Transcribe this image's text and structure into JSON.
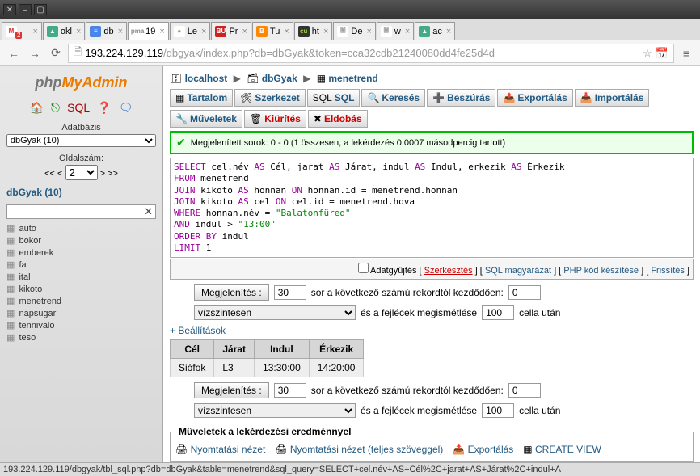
{
  "window": {
    "url_host": "193.224.129.119",
    "url_path": "/dbgyak/index.php?db=dbGyak&token=cca32cdb21240080dd4fe25d4d"
  },
  "browser_tabs": [
    {
      "label": "",
      "badge": "2",
      "ico": "M",
      "ico_bg": "#fff",
      "ico_color": "#d33"
    },
    {
      "label": "okl",
      "ico": "▲",
      "ico_bg": "#4a8",
      "ico_color": "#fff"
    },
    {
      "label": "db",
      "ico": "≡",
      "ico_bg": "#4a86e8",
      "ico_color": "#fff"
    },
    {
      "label": "19",
      "ico": "pma",
      "ico_bg": "#fff",
      "ico_color": "#888",
      "active": true
    },
    {
      "label": "Le",
      "ico": "●",
      "ico_bg": "#fff",
      "ico_color": "#7b5"
    },
    {
      "label": "Pr",
      "ico": "BU",
      "ico_bg": "#c22",
      "ico_color": "#fff"
    },
    {
      "label": "Tu",
      "ico": "B",
      "ico_bg": "#f80",
      "ico_color": "#fff"
    },
    {
      "label": "ht",
      "ico": "cu",
      "ico_bg": "#333",
      "ico_color": "#9c4"
    },
    {
      "label": "De",
      "ico": "🗎",
      "ico_bg": "#fff",
      "ico_color": "#888"
    },
    {
      "label": "w",
      "ico": "🗎",
      "ico_bg": "#fff",
      "ico_color": "#888"
    },
    {
      "label": "ac",
      "ico": "▲",
      "ico_bg": "#4a8",
      "ico_color": "#fff"
    }
  ],
  "sidebar": {
    "db_label": "Adatbázis",
    "db_select": "dbGyak (10)",
    "page_label": "Oldalszám:",
    "pager_prev": "<< <",
    "pager_val": "2",
    "pager_next": "> >>",
    "db_link": "dbGyak (10)",
    "tables": [
      "auto",
      "bokor",
      "emberek",
      "fa",
      "ital",
      "kikoto",
      "menetrend",
      "napsugar",
      "tennivalo",
      "teso"
    ]
  },
  "breadcrumb": {
    "server_ico": "🗄",
    "server": "localhost",
    "db_ico": "🗃",
    "db": "dbGyak",
    "tbl_ico": "▦",
    "tbl": "menetrend"
  },
  "ptabs1": [
    {
      "ico": "▦",
      "label": "Tartalom"
    },
    {
      "ico": "🛠",
      "label": "Szerkezet"
    },
    {
      "ico": "SQL",
      "label": "SQL"
    },
    {
      "ico": "🔍",
      "label": "Keresés"
    },
    {
      "ico": "➕",
      "label": "Beszúrás"
    },
    {
      "ico": "📤",
      "label": "Exportálás"
    },
    {
      "ico": "📥",
      "label": "Importálás"
    }
  ],
  "ptabs2": [
    {
      "ico": "🔧",
      "label": "Műveletek"
    },
    {
      "ico": "🗑",
      "label": "Kiürítés",
      "red": true
    },
    {
      "ico": "✖",
      "label": "Eldobás",
      "red": true
    }
  ],
  "success": "Megjelenített sorok: 0 - 0 (1 összesen, a lekérdezés 0.0007 másodpercig tartott)",
  "sql_actions": {
    "profile": "Adatgyűjtés",
    "edit": "Szerkesztés",
    "explain": "SQL magyarázat",
    "php": "PHP kód készítése",
    "refresh": "Frissítés"
  },
  "controls": {
    "show_btn": "Megjelenítés :",
    "show_val": "30",
    "start_label": "sor a következő számú rekordtól kezdődően:",
    "start_val": "0",
    "mode": "vízszintesen",
    "repeat_label": "és a fejlécek megismétlése",
    "repeat_val": "100",
    "repeat_after": "cella után"
  },
  "settings_link": "+ Beállítások",
  "result": {
    "headers": [
      "Cél",
      "Járat",
      "Indul",
      "Érkezik"
    ],
    "rows": [
      [
        "Siófok",
        "L3",
        "13:30:00",
        "14:20:00"
      ]
    ]
  },
  "ops": {
    "legend": "Műveletek a lekérdezési eredménnyel",
    "items": [
      "Nyomtatási nézet",
      "Nyomtatási nézet (teljes szöveggel)",
      "Exportálás",
      "CREATE VIEW"
    ]
  },
  "status": "193.224.129.119/dbgyak/tbl_sql.php?db=dbGyak&table=menetrend&sql_query=SELECT+cel.név+AS+Cél%2C+jarat+AS+Járat%2C+indul+A"
}
